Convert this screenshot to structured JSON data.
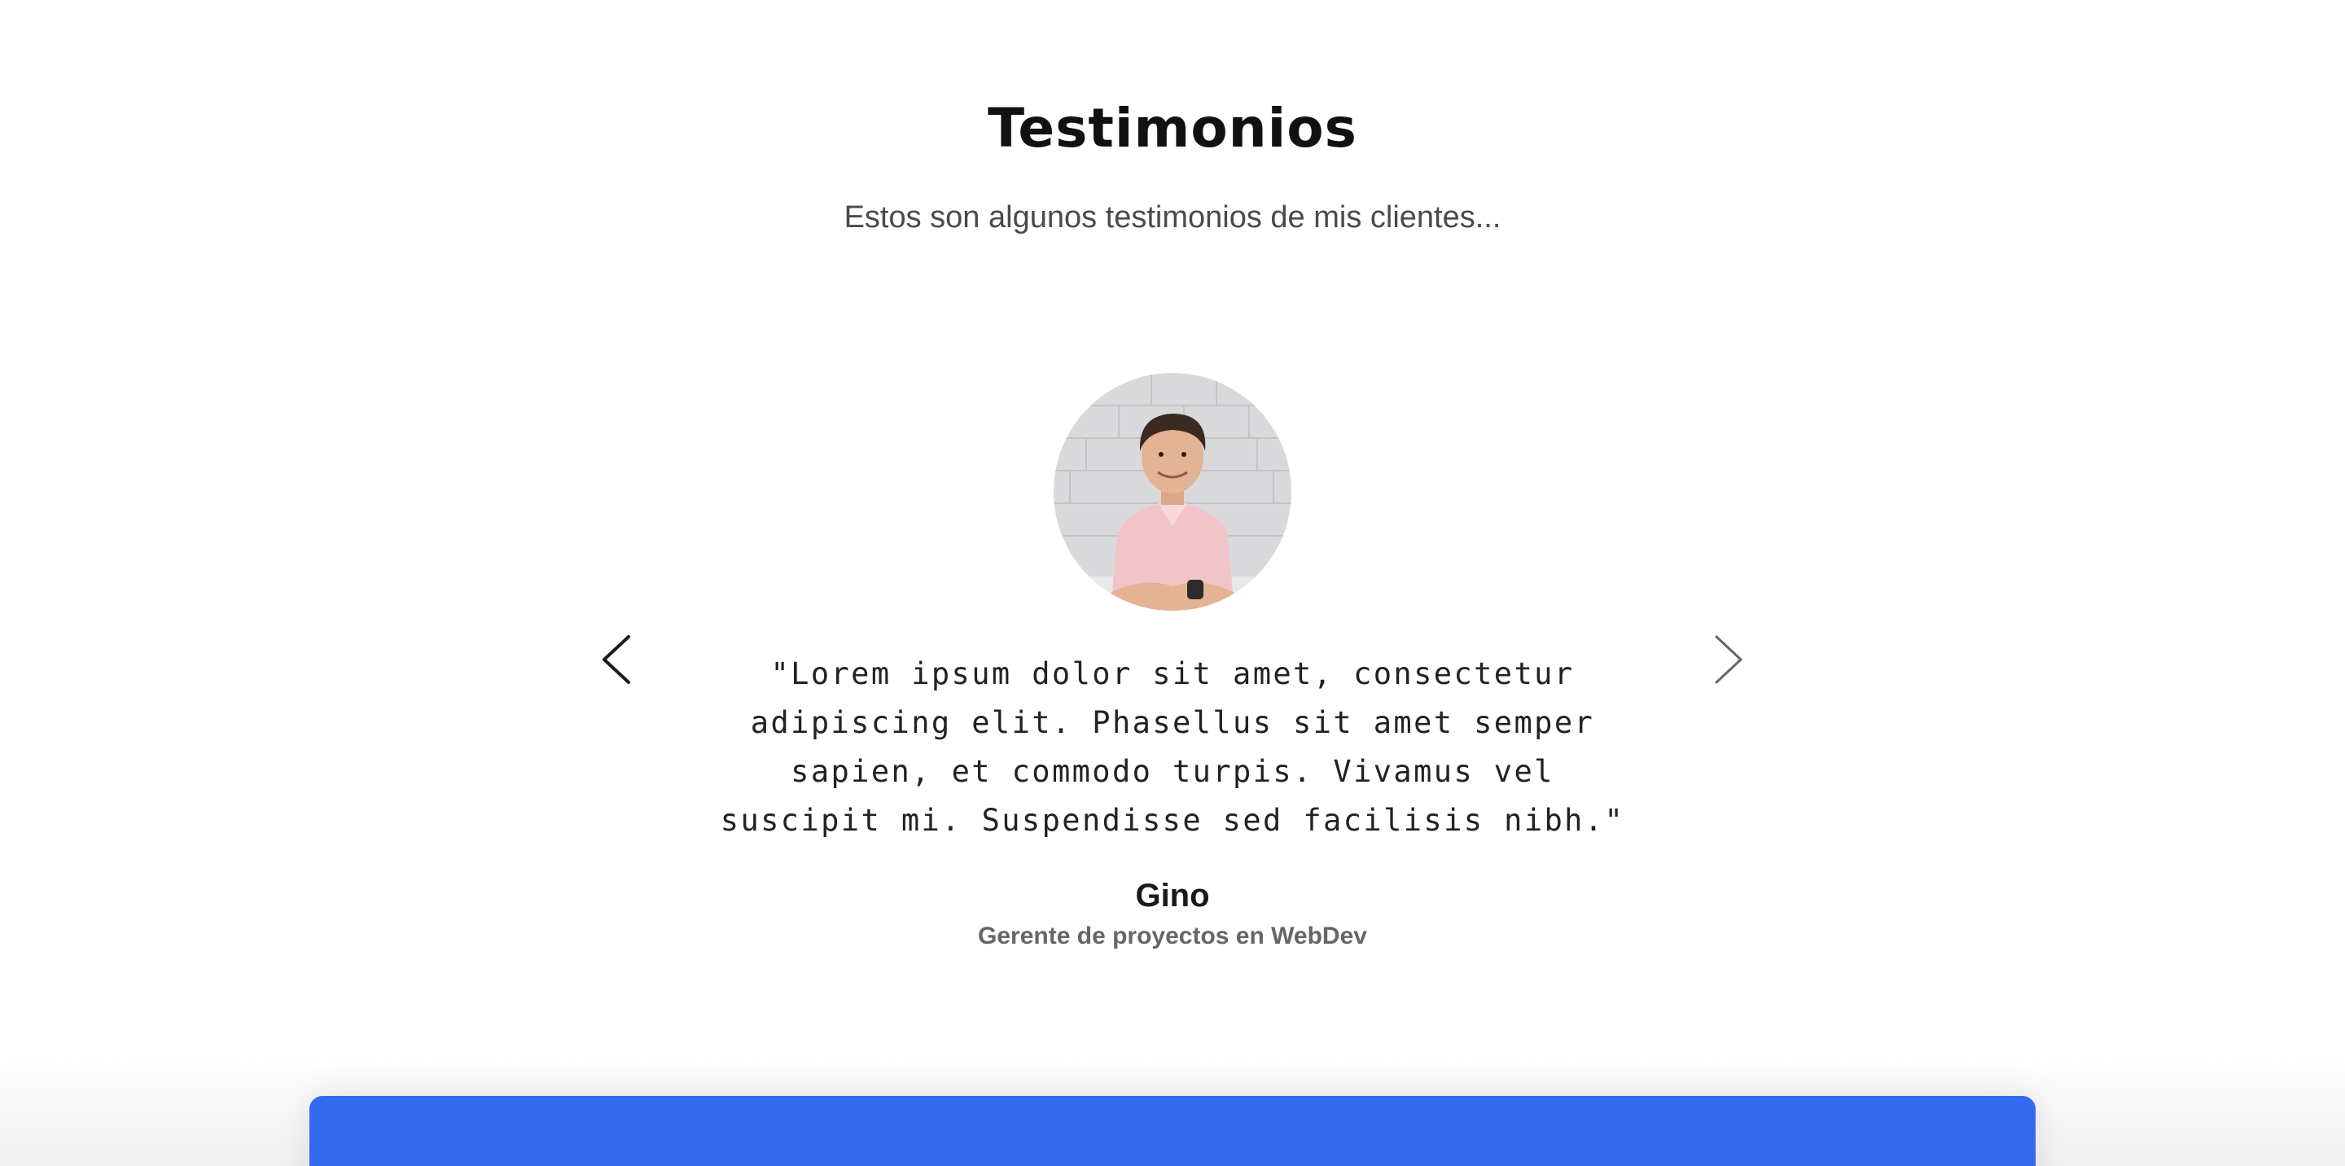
{
  "section": {
    "title": "Testimonios",
    "subtitle": "Estos son algunos testimonios de mis clientes..."
  },
  "carousel": {
    "prev_icon": "chevron-left-icon",
    "next_icon": "chevron-right-icon",
    "testimonial": {
      "quote": "\"Lorem ipsum dolor sit amet, consectetur adipiscing elit. Phasellus sit amet semper sapien, et commodo turpis. Vivamus vel suscipit mi. Suspendisse sed facilisis nibh.\"",
      "name": "Gino",
      "role": "Gerente de proyectos en WebDev"
    }
  },
  "colors": {
    "footer_accent": "#3369ee",
    "title_color": "#111111",
    "subtitle_color": "#4a4a4a"
  }
}
